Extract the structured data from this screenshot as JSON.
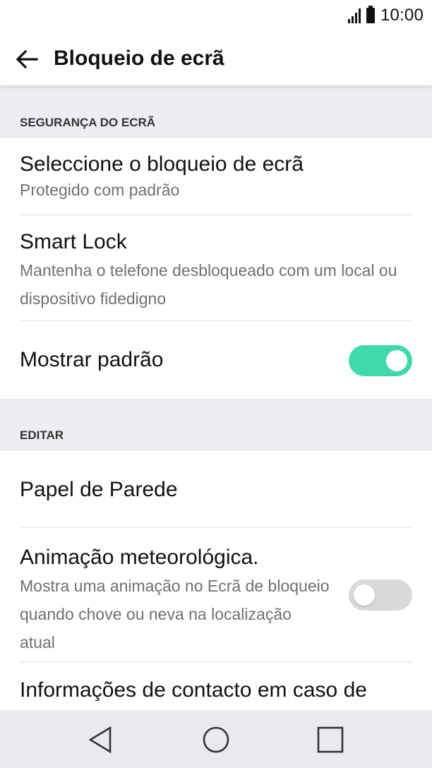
{
  "status_bar": {
    "time": "10:00",
    "icons": [
      "signal-icon",
      "battery-icon"
    ]
  },
  "app_bar": {
    "title": "Bloqueio de ecrã",
    "back_icon": "arrow-left-icon"
  },
  "sections": {
    "security": {
      "header": "SEGURANÇA DO ECRÃ",
      "select_lock": {
        "title": "Seleccione o bloqueio de ecrã",
        "subtitle": "Protegido com padrão"
      },
      "smart_lock": {
        "title": "Smart Lock",
        "subtitle": "Mantenha o telefone desbloqueado com um local ou dispositivo fidedigno"
      },
      "show_pattern": {
        "title": "Mostrar padrão",
        "enabled": true
      }
    },
    "edit": {
      "header": "EDITAR",
      "wallpaper": {
        "title": "Papel de Parede"
      },
      "weather_animation": {
        "title": "Animação meteorológica.",
        "subtitle": "Mostra uma animação no Ecrã de bloqueio quando chove ou neva na localização atual",
        "enabled": false
      },
      "contact_info": {
        "title": "Informações de contacto em caso de"
      }
    }
  },
  "nav_bar": {
    "icons": [
      "nav-back-icon",
      "nav-home-icon",
      "nav-recents-icon"
    ]
  },
  "colors": {
    "accent": "#3fd9ac",
    "toggle_off": "#d9d9d9",
    "section_bg": "#edeef2",
    "nav_bg": "#e9eaee"
  }
}
